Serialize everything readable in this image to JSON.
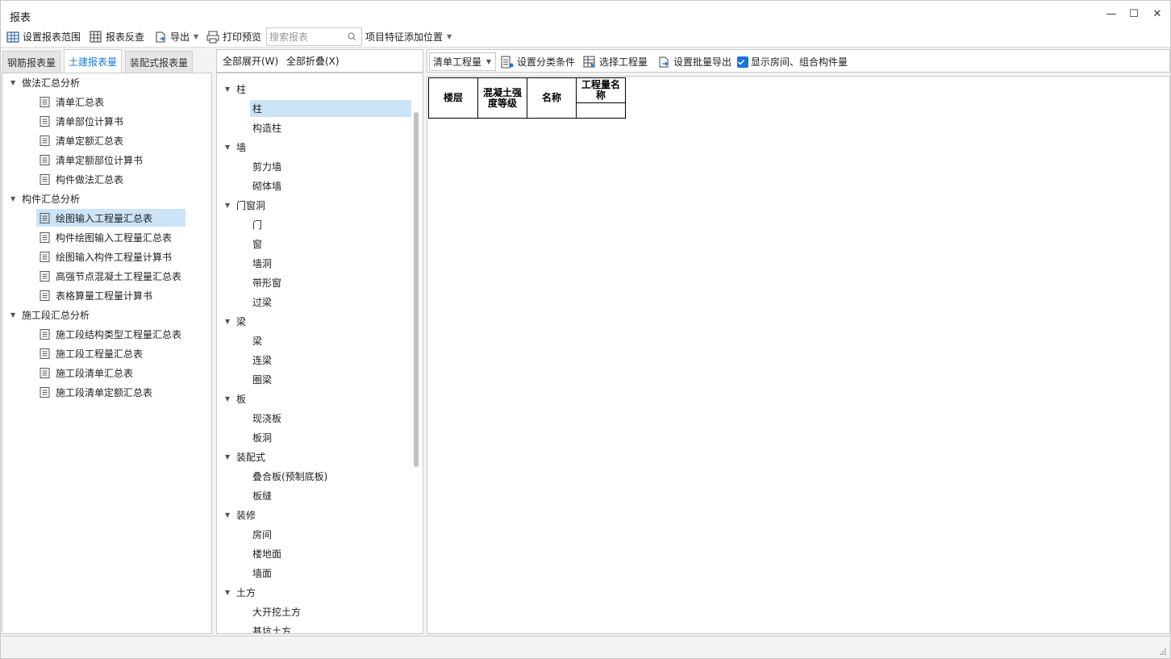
{
  "window": {
    "title": "报表",
    "minimize_icon": "—",
    "maximize_icon": "☐",
    "close_icon": "✕"
  },
  "toolbar": {
    "set_range": "设置报表范围",
    "reverse_check": "报表反查",
    "export": "导出",
    "print_preview": "打印预览",
    "search_placeholder": "搜索报表",
    "feature_position": "项目特征添加位置"
  },
  "left_tabs": [
    "钢筋报表量",
    "土建报表量",
    "装配式报表量"
  ],
  "left_tree": {
    "groups": [
      {
        "label": "做法汇总分析",
        "items": [
          "清单汇总表",
          "清单部位计算书",
          "清单定额汇总表",
          "清单定额部位计算书",
          "构件做法汇总表"
        ]
      },
      {
        "label": "构件汇总分析",
        "items": [
          "绘图输入工程量汇总表",
          "构件绘图输入工程量汇总表",
          "绘图输入构件工程量计算书",
          "高强节点混凝土工程量汇总表",
          "表格算量工程量计算书"
        ]
      },
      {
        "label": "施工段汇总分析",
        "items": [
          "施工段结构类型工程量汇总表",
          "施工段工程量汇总表",
          "施工段清单汇总表",
          "施工段清单定额汇总表"
        ]
      }
    ],
    "selected": "绘图输入工程量汇总表"
  },
  "middle": {
    "expand_all": "全部展开(W)",
    "collapse_all": "全部折叠(X)",
    "groups": [
      {
        "label": "柱",
        "items": [
          "柱",
          "构造柱"
        ]
      },
      {
        "label": "墙",
        "items": [
          "剪力墙",
          "砌体墙"
        ]
      },
      {
        "label": "门窗洞",
        "items": [
          "门",
          "窗",
          "墙洞",
          "带形窗",
          "过梁"
        ]
      },
      {
        "label": "梁",
        "items": [
          "梁",
          "连梁",
          "圈梁"
        ]
      },
      {
        "label": "板",
        "items": [
          "现浇板",
          "板洞"
        ]
      },
      {
        "label": "装配式",
        "items": [
          "叠合板(预制底板)",
          "板缝"
        ]
      },
      {
        "label": "装修",
        "items": [
          "房间",
          "楼地面",
          "墙面"
        ]
      },
      {
        "label": "土方",
        "items": [
          "大开挖土方",
          "基坑土方"
        ]
      }
    ],
    "selected": "柱"
  },
  "right": {
    "mode_select": "清单工程量",
    "set_classification": "设置分类条件",
    "select_quantity": "选择工程量",
    "batch_export": "设置批量导出",
    "show_rooms_label": "显示房间、组合构件量",
    "show_rooms_checked": true
  },
  "report_table": {
    "col_floor": "楼层",
    "col_grade": "混凝土强度等级",
    "col_name": "名称",
    "col_qty_name": "工程量名称",
    "sub_cell": ""
  },
  "colors": {
    "accent": "#1a7bd6",
    "selection": "#cce4f7",
    "checkbox": "#1a73d9"
  }
}
